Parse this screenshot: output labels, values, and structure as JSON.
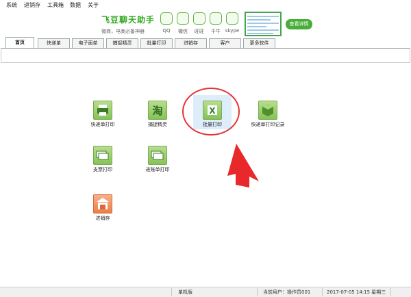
{
  "menu": [
    "系统",
    "进销存",
    "工具箱",
    "数据",
    "关于"
  ],
  "banner": {
    "title": "飞豆聊天助手",
    "subtitle": "微商，电商必备神器",
    "chat_apps": [
      "QQ",
      "微信",
      "旺旺",
      "千牛",
      "skype"
    ],
    "detail_button": "查看详情"
  },
  "tabs": [
    "首页",
    "快递单",
    "电子面单",
    "捕捉精灵",
    "批量打印",
    "进销存",
    "客户",
    "更多软件"
  ],
  "active_tab": "首页",
  "tiles": [
    {
      "label": "快递单打印",
      "icon": "printer-icon",
      "color": "green"
    },
    {
      "label": "捕捉精灵",
      "icon": "taobao-icon",
      "color": "green"
    },
    {
      "label": "批量打印",
      "icon": "excel-icon",
      "color": "green",
      "selected": true
    },
    {
      "label": "快递单打印记录",
      "icon": "box-icon",
      "color": "green"
    },
    {
      "label": "支票打印",
      "icon": "check-stack-icon",
      "color": "green"
    },
    {
      "label": "进账单打印",
      "icon": "deposit-stack-icon",
      "color": "green"
    },
    {
      "label": "进销存",
      "icon": "warehouse-icon",
      "color": "orange"
    }
  ],
  "status": {
    "edition": "单机版",
    "user_label": "当前用户：操作员001",
    "datetime": "2017-07-05 14:15 星期三"
  },
  "colors": {
    "brand_green": "#2fa81c",
    "highlight_red": "#e23535"
  }
}
